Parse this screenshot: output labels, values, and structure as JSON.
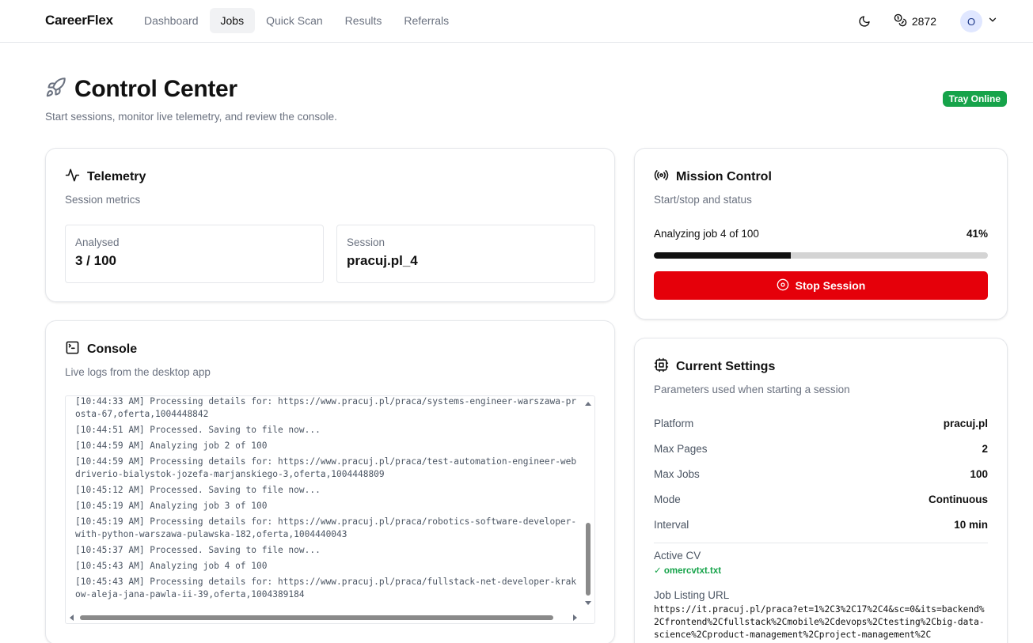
{
  "nav": {
    "brand": "CareerFlex",
    "links": [
      "Dashboard",
      "Jobs",
      "Quick Scan",
      "Results",
      "Referrals"
    ],
    "active": "Jobs",
    "credits": "2872",
    "avatar_initial": "O"
  },
  "header": {
    "title": "Control Center",
    "subtitle": "Start sessions, monitor live telemetry, and review the console.",
    "status_badge": "Tray Online"
  },
  "telemetry": {
    "title": "Telemetry",
    "subtitle": "Session metrics",
    "metrics": [
      {
        "label": "Analysed",
        "value": "3 / 100"
      },
      {
        "label": "Session",
        "value": "pracuj.pl_4"
      }
    ]
  },
  "console": {
    "title": "Console",
    "subtitle": "Live logs from the desktop app",
    "lines": [
      "[10:44:33 AM] Processing details for: https://www.pracuj.pl/praca/systems-engineer-warszawa-prosta-67,oferta,1004448842",
      "[10:44:51 AM] Processed. Saving to file now...",
      "[10:44:59 AM] Analyzing job 2 of 100",
      "[10:44:59 AM] Processing details for: https://www.pracuj.pl/praca/test-automation-engineer-webdriverio-bialystok-jozefa-marjanskiego-3,oferta,1004448809",
      "[10:45:12 AM] Processed. Saving to file now...",
      "[10:45:19 AM] Analyzing job 3 of 100",
      "[10:45:19 AM] Processing details for: https://www.pracuj.pl/praca/robotics-software-developer-with-python-warszawa-pulawska-182,oferta,1004440043",
      "[10:45:37 AM] Processed. Saving to file now...",
      "[10:45:43 AM] Analyzing job 4 of 100",
      "[10:45:43 AM] Processing details for: https://www.pracuj.pl/praca/fullstack-net-developer-krakow-aleja-jana-pawla-ii-39,oferta,1004389184"
    ]
  },
  "mission": {
    "title": "Mission Control",
    "subtitle": "Start/stop and status",
    "status": "Analyzing job 4 of 100",
    "progress_label": "41%",
    "progress": 0.41,
    "stop_label": "Stop Session"
  },
  "settings": {
    "title": "Current Settings",
    "subtitle": "Parameters used when starting a session",
    "rows": [
      {
        "key": "Platform",
        "value": "pracuj.pl"
      },
      {
        "key": "Max Pages",
        "value": "2"
      },
      {
        "key": "Max Jobs",
        "value": "100"
      },
      {
        "key": "Mode",
        "value": "Continuous"
      },
      {
        "key": "Interval",
        "value": "10 min"
      }
    ],
    "cv_label": "Active CV",
    "cv_value": "✓ omercvtxt.txt",
    "url_label": "Job Listing URL",
    "url_value": "https://it.pracuj.pl/praca?et=1%2C3%2C17%2C4&sc=0&its=backend%2Cfrontend%2Cfullstack%2Cmobile%2Cdevops%2Ctesting%2Cbig-data-science%2Cproduct-management%2Cproject-management%2C"
  },
  "colors": {
    "accent_red": "#e5000a",
    "online_green": "#16a34a"
  }
}
